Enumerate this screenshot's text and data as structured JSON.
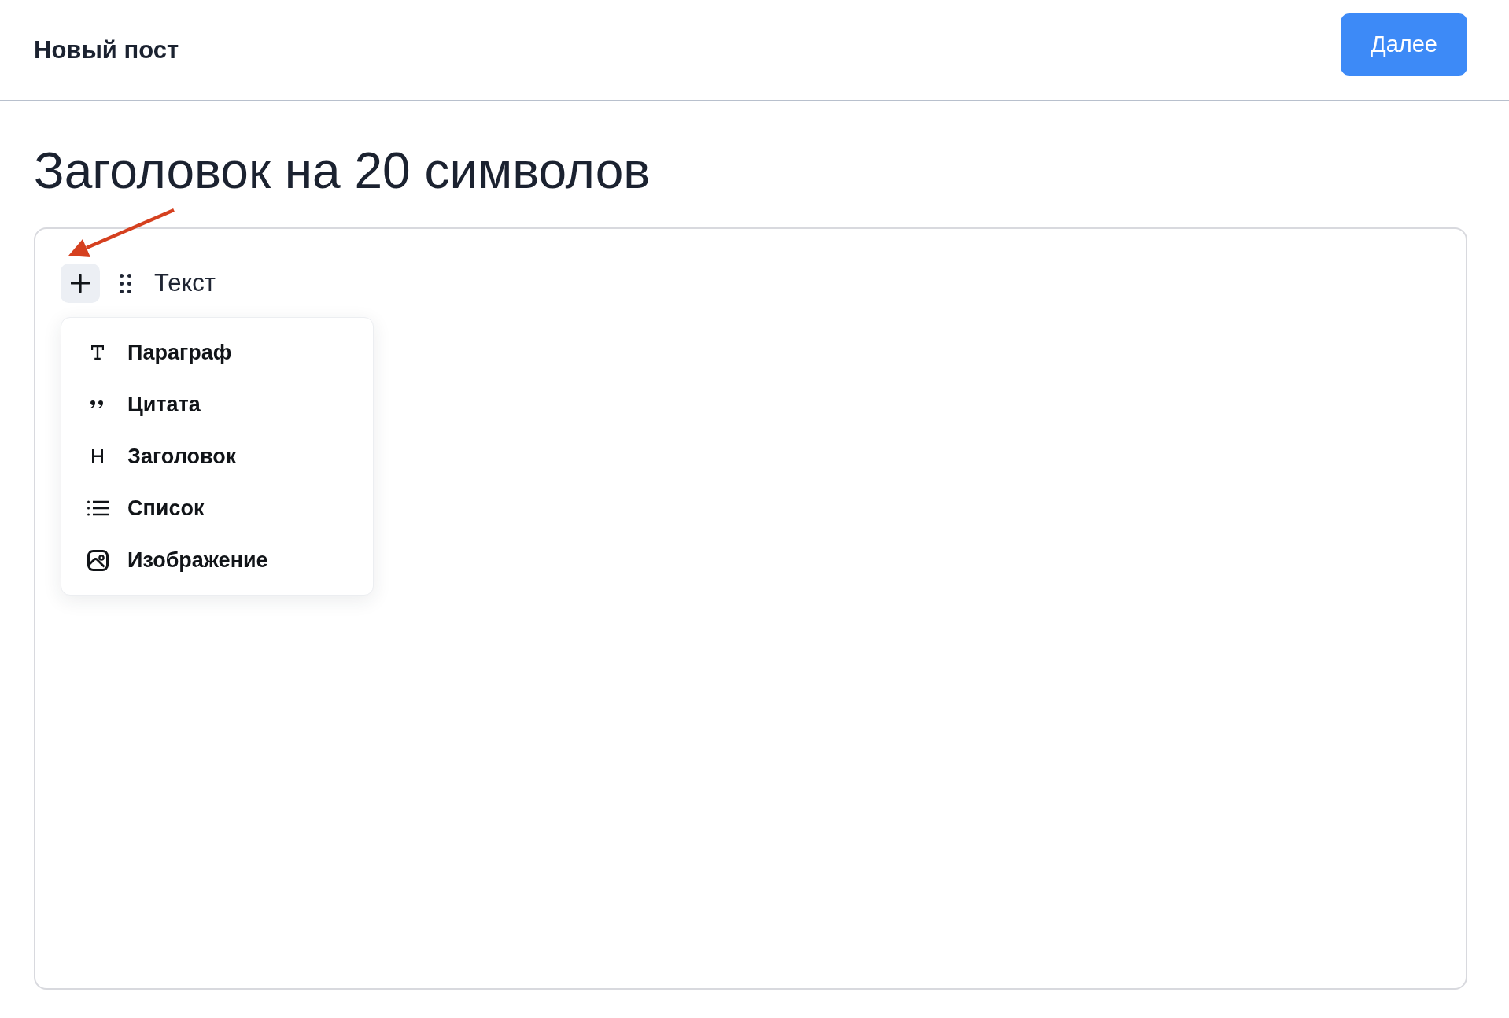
{
  "header": {
    "title": "Новый пост",
    "next_button": "Далее"
  },
  "post_title": "Заголовок на 20 символов",
  "editor": {
    "add_button": {
      "expanded": true
    },
    "block_text": "Текст",
    "block_menu": [
      {
        "kind": "paragraph",
        "label": "Параграф"
      },
      {
        "kind": "quote",
        "label": "Цитата"
      },
      {
        "kind": "heading",
        "label": "Заголовок"
      },
      {
        "kind": "list",
        "label": "Список"
      },
      {
        "kind": "image",
        "label": "Изображение"
      }
    ]
  }
}
